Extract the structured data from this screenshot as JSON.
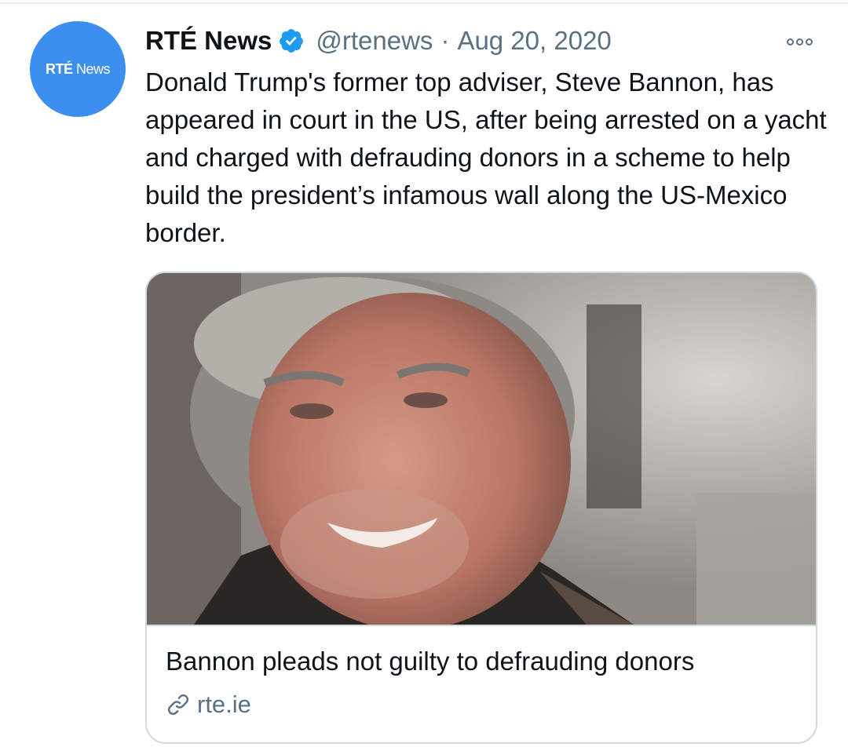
{
  "account": {
    "name": "RTÉ News",
    "handle": "@rtenews",
    "separator": "·",
    "date": "Aug 20, 2020",
    "avatar_logo_bold": "RTÉ",
    "avatar_logo_light": "News",
    "avatar_color": "#3b8fee",
    "verified": true
  },
  "tweet": {
    "text": "Donald Trump's former top adviser, Steve Bannon, has appeared in court in the US, after being arrested on a yacht and charged with defrauding donors in a scheme to help build the president’s infamous wall along the US-Mexico border."
  },
  "card": {
    "image_alt": "photo",
    "title": "Bannon pleads not guilty to defrauding donors",
    "domain": "rte.ie",
    "icon": "link-icon"
  },
  "icons": {
    "verified": "verified-badge-icon",
    "more": "more-options-icon",
    "link": "link-icon"
  },
  "colors": {
    "text": "#0f1419",
    "secondary": "#5b7083",
    "verified": "#1d9bf0",
    "border": "#cfd9de"
  }
}
